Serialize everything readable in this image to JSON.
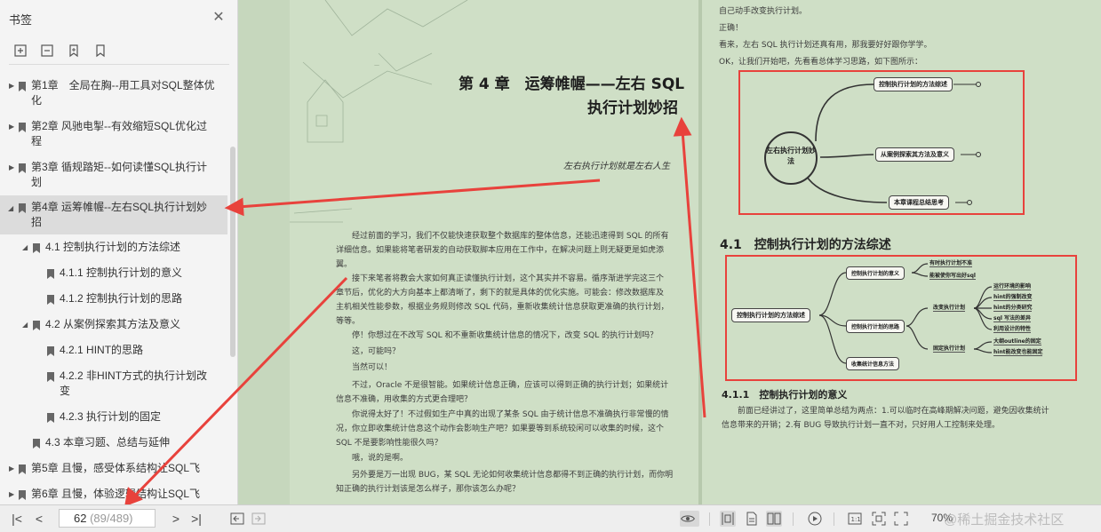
{
  "sidebar": {
    "title": "书签",
    "tree": [
      {
        "label1": "第1章　全局在胸--用工具对SQL整体优",
        "label2": "化"
      },
      {
        "label1": "第2章 风驰电掣--有效缩短SQL优化过",
        "label2": "程"
      },
      {
        "label1": "第3章 循规踏矩--如何读懂SQL执行计",
        "label2": "划"
      },
      {
        "label1": "第4章 运筹帷幄--左右SQL执行计划妙",
        "label2": "招"
      },
      {
        "label1": "4.1 控制执行计划的方法综述"
      },
      {
        "label1": "4.1.1 控制执行计划的意义"
      },
      {
        "label1": "4.1.2 控制执行计划的思路"
      },
      {
        "label1": "4.2 从案例探索其方法及意义"
      },
      {
        "label1": "4.2.1 HINT的思路"
      },
      {
        "label1": "4.2.2 非HINT方式的执行计划改",
        "label2": "变"
      },
      {
        "label1": "4.2.3 执行计划的固定"
      },
      {
        "label1": "4.3 本章习题、总结与延伸"
      },
      {
        "label1": "第5章 且慢，感受体系结构让SQL飞"
      },
      {
        "label1": "第6章 且慢，体验逻辑结构让SQL飞"
      }
    ]
  },
  "left_page": {
    "chapter_title_1": "第 4 章　运筹帷幄——左右 SQL",
    "chapter_title_2": "执行计划妙招",
    "epigraph": "左右执行计划就是左右人生",
    "paragraphs": [
      [
        "　　经过前面的学习，我们不仅能快速获取整个数据库的整体信息，还能迅速得到 SQL 的所有",
        "详细信息。如果能将笔者研发的自动获取脚本应用在工作中，在解决问题上则无疑更是如虎添",
        "翼。"
      ],
      [
        "　　接下来笔者将教会大家如何真正读懂执行计划，这个其实并不容易。循序渐进学完这三个",
        "章节后，优化的大方向基本上都清晰了，剩下的就是具体的优化实施。可能会：修改数据库及",
        "主机相关性能参数，根据业务规则修改 SQL 代码，重新收集统计信息获取更准确的执行计划，",
        "等等。"
      ],
      [
        "　　停！你想过在不改写 SQL 和不重新收集统计信息的情况下，改变 SQL 的执行计划吗？"
      ],
      [
        "　　这，可能吗？"
      ],
      [
        "　　当然可以！"
      ],
      [
        "　　不过，Oracle 不是很智能。如果统计信息正确，应该可以得到正确的执行计划；如果统计",
        "信息不准确，用收集的方式更合理吧？"
      ],
      [
        "　　你说得太好了！不过假如生产中真的出现了某条 SQL 由于统计信息不准确执行非常慢的情",
        "况，你立即收集统计信息这个动作会影响生产吧？如果要等到系统较闲可以收集的时候，这个",
        "SQL 不是要影响性能很久吗？"
      ],
      [
        "　　哦，说的是啊。"
      ],
      [
        "　　另外要是万一出现 BUG，某 SQL 无论如何收集统计信息都得不到正确的执行计划，而你明",
        "知正确的执行计划该是怎么样子，那你该怎么办呢？"
      ]
    ]
  },
  "right_page": {
    "intro": [
      "自己动手改变执行计划。",
      "正确！",
      "看来，左右 SQL 执行计划还真有用，那我要好好跟你学学。",
      "OK，让我们开始吧，先看看总体学习思路，如下图所示："
    ],
    "mindmap1": {
      "center": "左右执行计划妙法",
      "nodes": [
        "控制执行计划的方法综述",
        "从案例探索其方法及意义",
        "本章课程总结思考"
      ]
    },
    "section_41": "4.1　控制执行计划的方法综述",
    "mindmap2": {
      "root": "控制执行计划的方法综述",
      "l1": [
        "控制执行计划的意义",
        "控制执行计划的思路",
        "收集统计信息方法"
      ],
      "meaning": [
        "有时执行计划不准",
        "能被使你写出好sql"
      ],
      "l2": [
        "改变执行计划",
        "固定执行计划"
      ],
      "change": [
        "运行环境的影响",
        "hint的强制改变",
        "hint的分类研究",
        "sql 写法的差异",
        "利用设计的特性"
      ],
      "fix": [
        "大纲outline的固定",
        "hint能改变也能固定"
      ]
    },
    "section_411": "4.1.1　控制执行计划的意义",
    "para": [
      "　　前面已经讲过了，这里简单总结为两点：1.可以临时在高峰期解决问题，避免因收集统计",
      "信息带来的开销；2.有 BUG 导致执行计划一直不对，只好用人工控制来处理。"
    ]
  },
  "bottombar": {
    "page_value": "62",
    "page_sub": "(89/489)",
    "zoom": "70%",
    "watermark": "@稀土掘金技术社区"
  }
}
